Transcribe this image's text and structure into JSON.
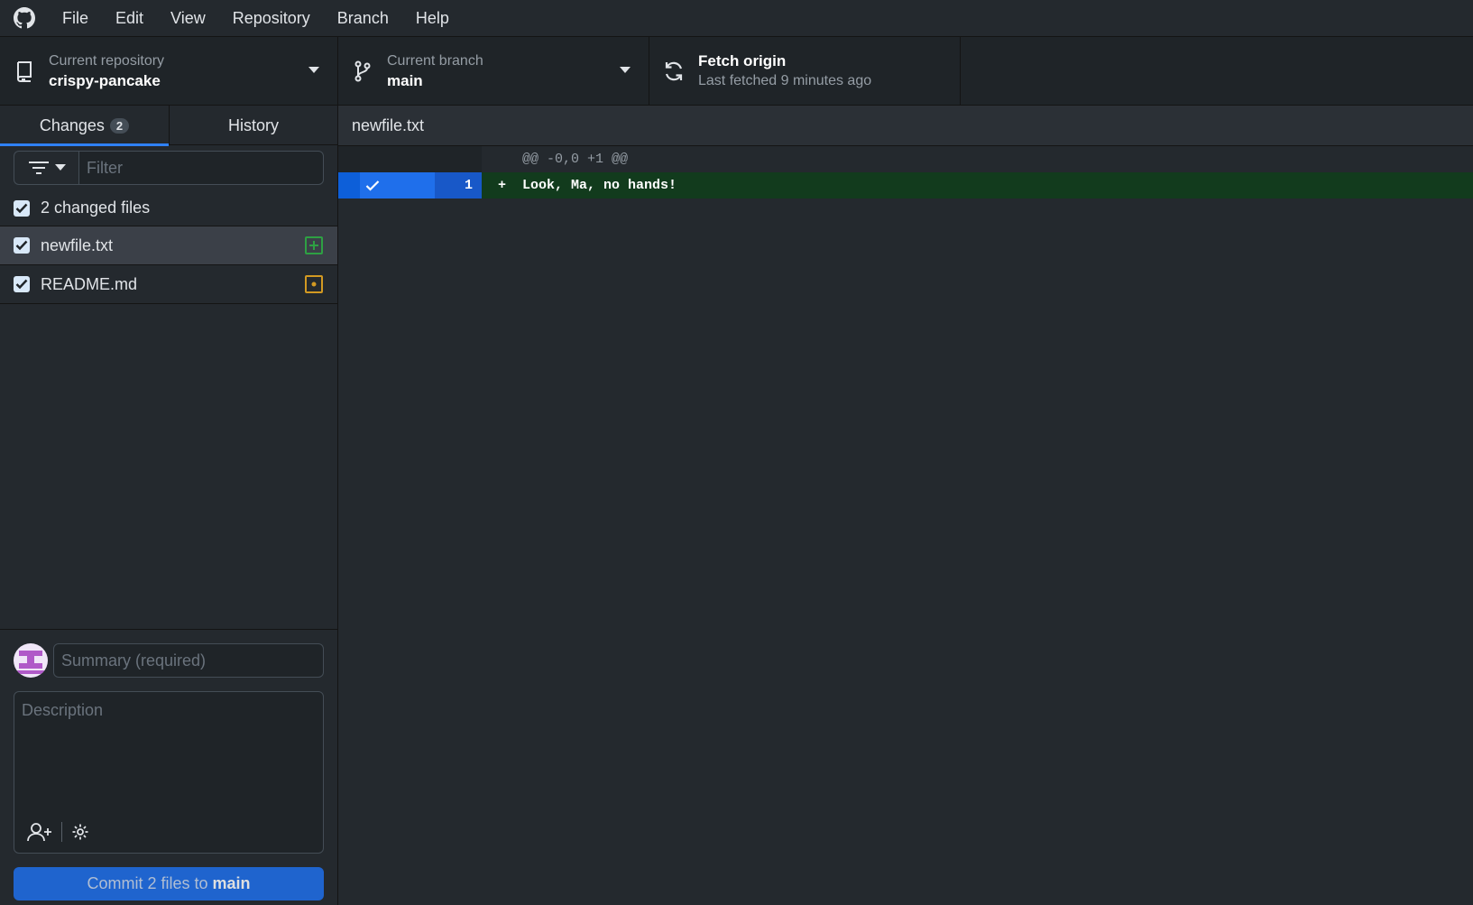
{
  "menu": {
    "items": [
      "File",
      "Edit",
      "View",
      "Repository",
      "Branch",
      "Help"
    ]
  },
  "toolbar": {
    "repo_label": "Current repository",
    "repo_value": "crispy-pancake",
    "branch_label": "Current branch",
    "branch_value": "main",
    "fetch_title": "Fetch origin",
    "fetch_subtitle": "Last fetched 9 minutes ago"
  },
  "sidebar": {
    "tabs": [
      {
        "label": "Changes",
        "count": "2"
      },
      {
        "label": "History"
      }
    ],
    "filter_placeholder": "Filter",
    "changed_files_label": "2 changed files",
    "files": [
      {
        "name": "newfile.txt",
        "status": "added"
      },
      {
        "name": "README.md",
        "status": "modified"
      }
    ]
  },
  "commit": {
    "summary_placeholder": "Summary (required)",
    "description_placeholder": "Description",
    "button_prefix": "Commit 2 files to",
    "button_branch": "main"
  },
  "diff": {
    "file_name": "newfile.txt",
    "hunk_header": "@@ -0,0 +1 @@",
    "lines": [
      {
        "number": "1",
        "sign": "+",
        "text": "Look, Ma, no hands!"
      }
    ]
  },
  "colors": {
    "accent": "#2f81f7",
    "added": "#2ea043",
    "modified": "#d29922",
    "commit_button": "#1f6feb"
  }
}
